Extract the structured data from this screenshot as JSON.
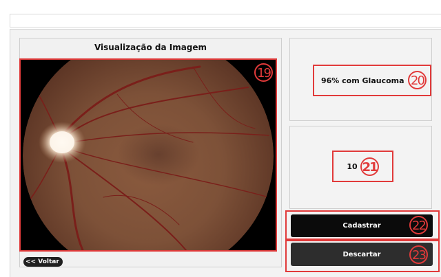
{
  "image_panel": {
    "title": "Visualização da Imagem",
    "image_marker": "19",
    "back_button": "<< Voltar"
  },
  "result_panel": {
    "diagnosis": "96% com Glaucoma",
    "marker": "20"
  },
  "count_panel": {
    "value": "10",
    "marker": "21"
  },
  "actions": {
    "register": "Cadastrar",
    "register_marker": "22",
    "discard": "Descartar",
    "discard_marker": "23"
  },
  "colors": {
    "annotation_red": "#e13a3a",
    "register_button": "#0b0b0b",
    "discard_button": "#2d2d2d"
  }
}
